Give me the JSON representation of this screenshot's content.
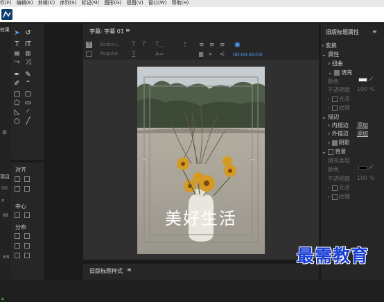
{
  "menu": [
    "件(F)",
    "编辑(E)",
    "剪辑(C)",
    "序列(S)",
    "标记(M)",
    "图形(G)",
    "视图(V)",
    "窗口(W)",
    "帮助(H)"
  ],
  "left_panel": {
    "tab_short": "效果",
    "project_short": "项目",
    "value1": "68",
    "value2": "53("
  },
  "align_panel": {
    "title": "对齐",
    "center": "中心",
    "distribute": "分布"
  },
  "title_panel": {
    "tab": "字幕: 字幕 01",
    "font": "Bodoni…",
    "style": "Regular",
    "timecode": "00:00:00:00",
    "caption": "美好生活"
  },
  "bottom_panel": {
    "tab": "旧版标题样式"
  },
  "properties_panel": {
    "title": "旧版标题属性",
    "transform": "变换",
    "properties": "属性",
    "distort": "扭曲",
    "fill": "填充",
    "color": "颜色",
    "opacity": "不透明度",
    "opacity_value": "100 %",
    "sheen": "光泽",
    "texture": "纹理",
    "strokes": "描边",
    "inner_stroke": "内描边",
    "outer_stroke": "外描边",
    "add": "添加",
    "shadow": "阴影",
    "background": "背景",
    "fill_type": "填充类型",
    "fill_color": "#eeeeee",
    "background_color": "#000000"
  },
  "watermark": "最需教育"
}
